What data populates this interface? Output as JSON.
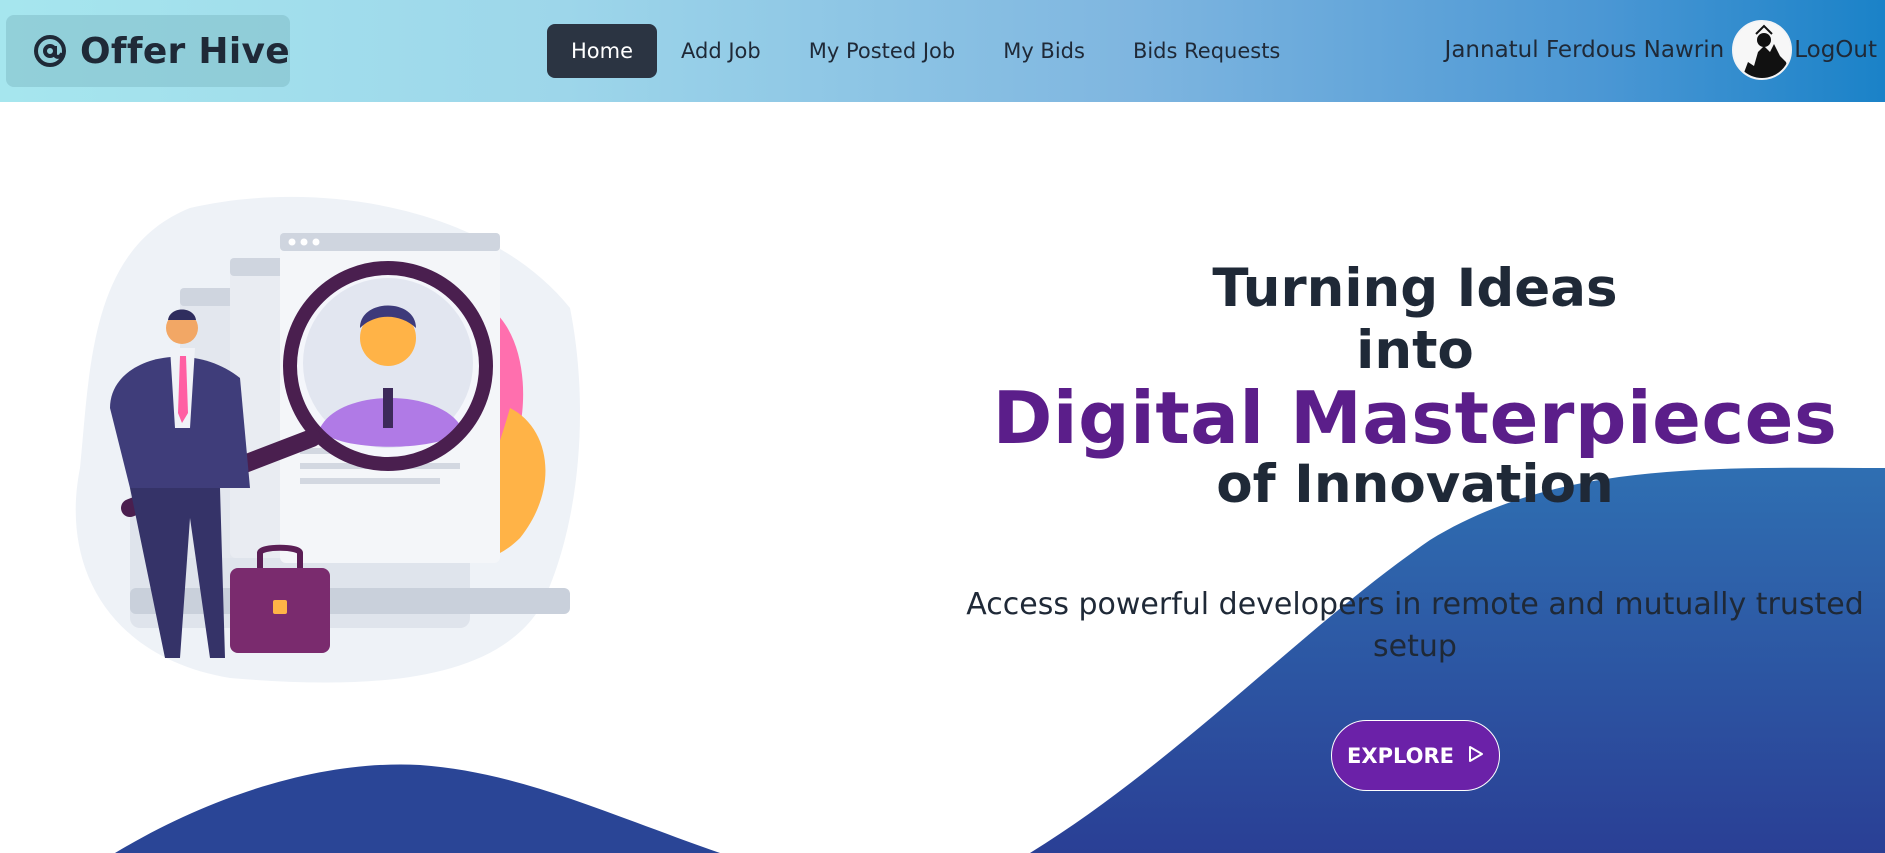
{
  "brand": {
    "name": "Offer Hive",
    "icon": "at-sign-icon"
  },
  "nav": {
    "items": [
      {
        "label": "Home",
        "active": true
      },
      {
        "label": "Add Job",
        "active": false
      },
      {
        "label": "My Posted Job",
        "active": false
      },
      {
        "label": "My Bids",
        "active": false
      },
      {
        "label": "Bids Requests",
        "active": false
      }
    ]
  },
  "user": {
    "name": "Jannatul Ferdous Nawrin",
    "logout_label": "LogOut"
  },
  "hero": {
    "line1": "Turning Ideas",
    "line2": "into",
    "accent": "Digital Masterpieces",
    "line3": "of Innovation",
    "subtext": "Access powerful developers in remote and mutually trusted setup",
    "cta_label": "EXPLORE",
    "cta_icon": "play-outline-icon"
  },
  "colors": {
    "accent_purple": "#5b1e8a",
    "button_purple": "#6b21a8",
    "active_nav": "#2b3442",
    "wave_blue": "#2a4f9e"
  }
}
